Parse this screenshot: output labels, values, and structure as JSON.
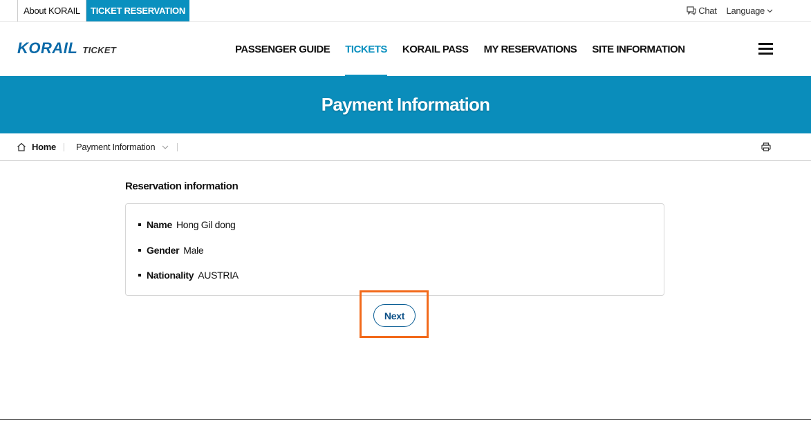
{
  "topbar": {
    "about_label": "About KORAIL",
    "ticket_label": "TICKET RESERVATION",
    "chat_label": "Chat",
    "language_label": "Language"
  },
  "header": {
    "logo_text": "KORAIL",
    "logo_sub": "TICKET",
    "nav": [
      {
        "label": "PASSENGER GUIDE",
        "active": false
      },
      {
        "label": "TICKETS",
        "active": true
      },
      {
        "label": "KORAIL PASS",
        "active": false
      },
      {
        "label": "MY RESERVATIONS",
        "active": false
      },
      {
        "label": "SITE INFORMATION",
        "active": false
      }
    ]
  },
  "banner": {
    "title": "Payment Information"
  },
  "breadcrumb": {
    "home": "Home",
    "current": "Payment Information"
  },
  "reservation": {
    "section_title": "Reservation information",
    "fields": [
      {
        "label": "Name",
        "value": "Hong Gil dong"
      },
      {
        "label": "Gender",
        "value": "Male"
      },
      {
        "label": "Nationality",
        "value": "AUSTRIA"
      }
    ]
  },
  "actions": {
    "next_label": "Next"
  },
  "colors": {
    "brand": "#0a90bf",
    "banner": "#0a8dbb",
    "highlight": "#f26a1b",
    "button_text": "#0b4f86"
  }
}
